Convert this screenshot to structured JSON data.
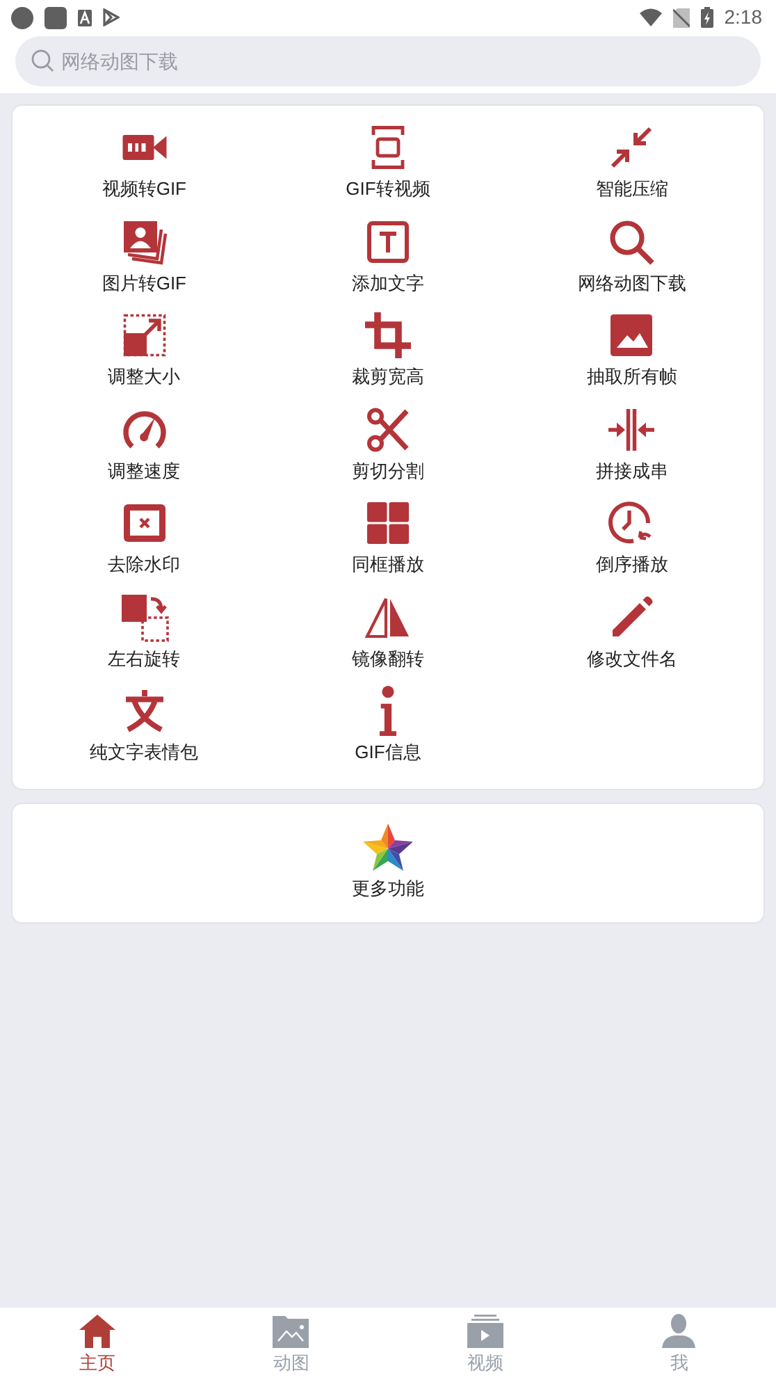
{
  "status_bar": {
    "time": "2:18"
  },
  "search": {
    "placeholder": "网络动图下载"
  },
  "tools": [
    {
      "label": "视频转GIF"
    },
    {
      "label": "GIF转视频"
    },
    {
      "label": "智能压缩"
    },
    {
      "label": "图片转GIF"
    },
    {
      "label": "添加文字"
    },
    {
      "label": "网络动图下载"
    },
    {
      "label": "调整大小"
    },
    {
      "label": "裁剪宽高"
    },
    {
      "label": "抽取所有帧"
    },
    {
      "label": "调整速度"
    },
    {
      "label": "剪切分割"
    },
    {
      "label": "拼接成串"
    },
    {
      "label": "去除水印"
    },
    {
      "label": "同框播放"
    },
    {
      "label": "倒序播放"
    },
    {
      "label": "左右旋转"
    },
    {
      "label": "镜像翻转"
    },
    {
      "label": "修改文件名"
    },
    {
      "label": "纯文字表情包"
    },
    {
      "label": "GIF信息"
    }
  ],
  "more": {
    "label": "更多功能"
  },
  "bottom_nav": [
    {
      "label": "主页",
      "selected": true
    },
    {
      "label": "动图",
      "selected": false
    },
    {
      "label": "视频",
      "selected": false
    },
    {
      "label": "我",
      "selected": false
    }
  ]
}
